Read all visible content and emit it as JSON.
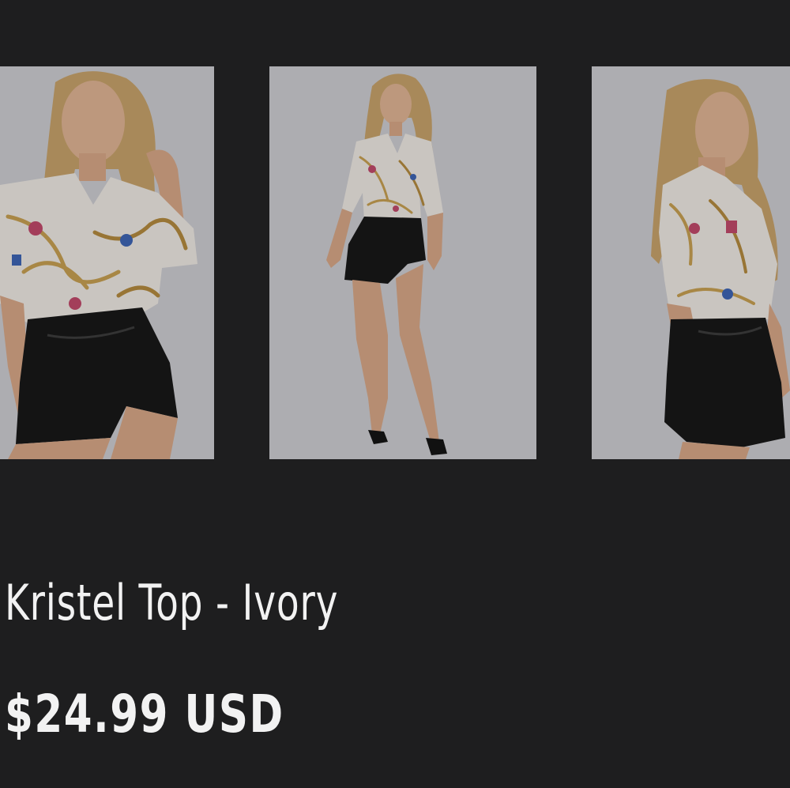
{
  "gallery": {
    "images": [
      {
        "icon": "model-front-closeup-photo",
        "alt": "Kristel Top - Ivory"
      },
      {
        "icon": "model-full-length-photo",
        "alt": "Kristel Top - Ivory"
      },
      {
        "icon": "model-side-view-photo",
        "alt": "Kristel Top - Ivory"
      }
    ]
  },
  "product": {
    "title": "Kristel Top - Ivory",
    "price": "$24.99 USD"
  },
  "colors": {
    "background": "#1e1e1f",
    "photo_background": "#cfcfd3",
    "text": "#f2f2f2"
  }
}
